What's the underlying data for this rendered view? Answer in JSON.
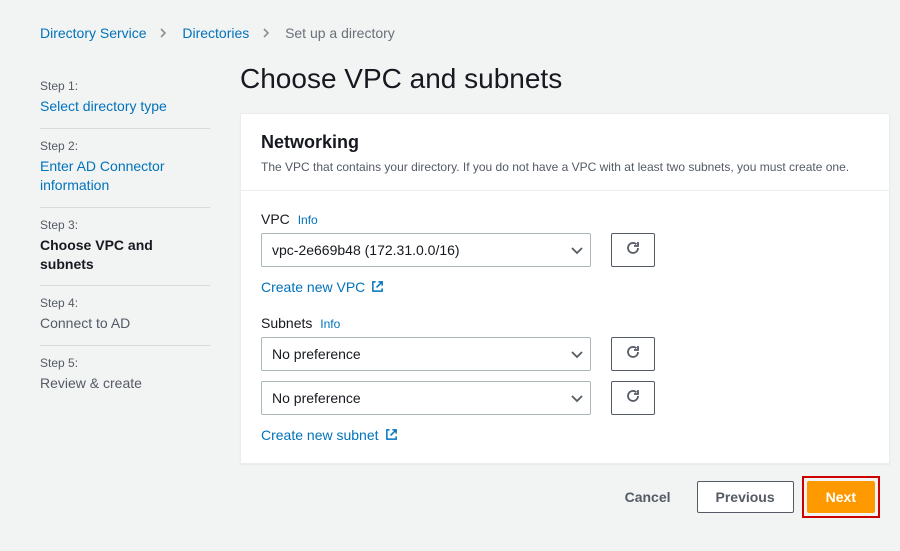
{
  "breadcrumb": {
    "directory_service": "Directory Service",
    "directories": "Directories",
    "current": "Set up a directory"
  },
  "steps": {
    "s1_label": "Step 1:",
    "s1_text": "Select directory type",
    "s2_label": "Step 2:",
    "s2_text": "Enter AD Connector information",
    "s3_label": "Step 3:",
    "s3_text": "Choose VPC and subnets",
    "s4_label": "Step 4:",
    "s4_text": "Connect to AD",
    "s5_label": "Step 5:",
    "s5_text": "Review & create"
  },
  "page_title": "Choose VPC and subnets",
  "networking": {
    "heading": "Networking",
    "description": "The VPC that contains your directory. If you do not have a VPC with at least two subnets, you must create one.",
    "vpc_label": "VPC",
    "info_label": "Info",
    "vpc_value": "vpc-2e669b48 (172.31.0.0/16)",
    "create_vpc": "Create new VPC",
    "subnets_label": "Subnets",
    "subnet1_value": "No preference",
    "subnet2_value": "No preference",
    "create_subnet": "Create new subnet"
  },
  "footer": {
    "cancel": "Cancel",
    "previous": "Previous",
    "next": "Next"
  },
  "colors": {
    "link": "#0073bb",
    "primary": "#ff9900",
    "highlight_border": "#c00"
  }
}
